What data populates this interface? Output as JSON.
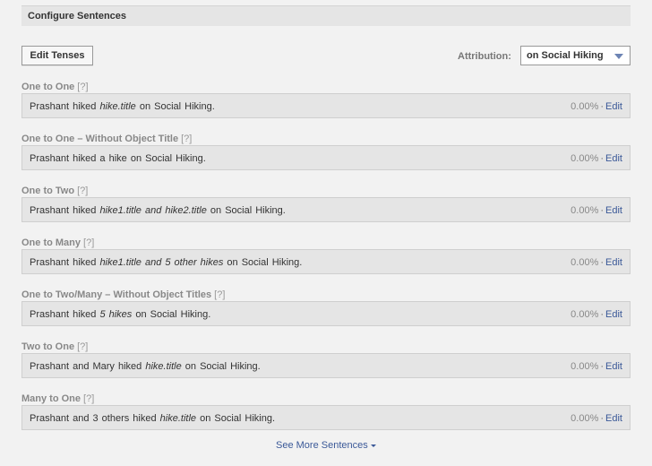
{
  "header": {
    "title": "Configure Sentences"
  },
  "toolbar": {
    "edit_tenses_label": "Edit Tenses",
    "attribution_label": "Attribution:",
    "attribution_value": "on Social Hiking"
  },
  "help_label": "[?]",
  "sections": [
    {
      "label": "One to One",
      "sentence": {
        "before": "Prashant hiked ",
        "object": "hike.title",
        "after": " on Social Hiking."
      },
      "percent": "0.00%",
      "edit_label": "Edit"
    },
    {
      "label": "One to One – Without Object Title",
      "sentence": {
        "before": "Prashant hiked a hike on Social Hiking.",
        "object": "",
        "after": ""
      },
      "percent": "0.00%",
      "edit_label": "Edit"
    },
    {
      "label": "One to Two",
      "sentence": {
        "before": "Prashant hiked ",
        "object": "hike1.title and hike2.title",
        "after": " on Social Hiking."
      },
      "percent": "0.00%",
      "edit_label": "Edit"
    },
    {
      "label": "One to Many",
      "sentence": {
        "before": "Prashant hiked ",
        "object": "hike1.title and 5 other hikes",
        "after": " on Social Hiking."
      },
      "percent": "0.00%",
      "edit_label": "Edit"
    },
    {
      "label": "One to Two/Many – Without Object Titles",
      "sentence": {
        "before": "Prashant hiked ",
        "object": "5 hikes",
        "after": " on Social Hiking."
      },
      "percent": "0.00%",
      "edit_label": "Edit"
    },
    {
      "label": "Two to One",
      "sentence": {
        "before": "Prashant and Mary hiked ",
        "object": "hike.title",
        "after": " on Social Hiking."
      },
      "percent": "0.00%",
      "edit_label": "Edit"
    },
    {
      "label": "Many to One",
      "sentence": {
        "before": "Prashant and 3 others hiked ",
        "object": "hike.title",
        "after": " on Social Hiking."
      },
      "percent": "0.00%",
      "edit_label": "Edit"
    }
  ],
  "footer": {
    "see_more_label": "See More Sentences"
  },
  "icons": {
    "attribution_caret": "chevron-down-icon",
    "see_more_caret": "caret-down-icon"
  },
  "colors": {
    "link": "#3b5998",
    "caret": "#6d84b4"
  }
}
